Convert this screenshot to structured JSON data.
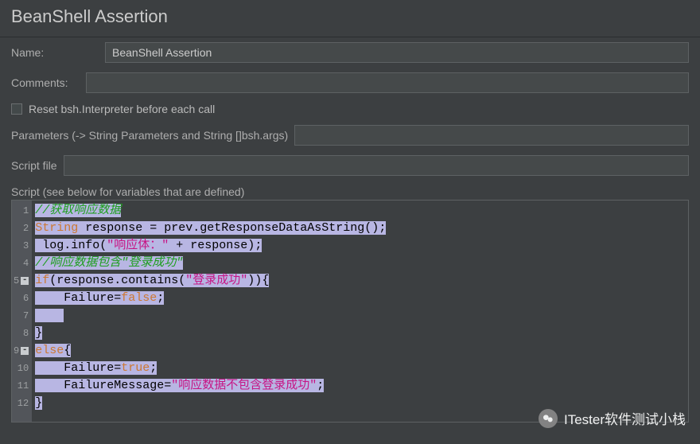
{
  "header": {
    "title": "BeanShell Assertion"
  },
  "fields": {
    "name_label": "Name:",
    "name_value": "BeanShell Assertion",
    "comments_label": "Comments:",
    "comments_value": "",
    "reset_label": "Reset bsh.Interpreter before each call",
    "reset_checked": false,
    "parameters_label": "Parameters (-> String Parameters and String []bsh.args)",
    "parameters_value": "",
    "scriptfile_label": "Script file",
    "scriptfile_value": "",
    "script_label": "Script (see below for variables that are defined)"
  },
  "code": {
    "lines": [
      {
        "n": 1,
        "fold": "",
        "tokens": [
          [
            "comment",
            "//获取响应数据"
          ]
        ]
      },
      {
        "n": 2,
        "fold": "",
        "tokens": [
          [
            "type",
            "String"
          ],
          [
            "ident",
            " response "
          ],
          [
            "op",
            "="
          ],
          [
            "ident",
            " prev.getResponseDataAsString"
          ],
          [
            "paren",
            "()"
          ],
          [
            "op",
            ";"
          ]
        ]
      },
      {
        "n": 3,
        "fold": "",
        "tokens": [
          [
            "ident",
            " log.info"
          ],
          [
            "paren",
            "("
          ],
          [
            "string",
            "\"响应体：\""
          ],
          [
            "ident",
            " "
          ],
          [
            "op",
            "+"
          ],
          [
            "ident",
            " response"
          ],
          [
            "paren",
            ")"
          ],
          [
            "op",
            ";"
          ]
        ]
      },
      {
        "n": 4,
        "fold": "",
        "tokens": [
          [
            "comment",
            "//响应数据包含\"登录成功\""
          ]
        ]
      },
      {
        "n": 5,
        "fold": "-",
        "tokens": [
          [
            "keyword",
            "if"
          ],
          [
            "paren",
            "("
          ],
          [
            "ident",
            "response.contains"
          ],
          [
            "paren",
            "("
          ],
          [
            "string",
            "\"登录成功\""
          ],
          [
            "paren",
            "))"
          ],
          [
            "paren",
            "{"
          ]
        ]
      },
      {
        "n": 6,
        "fold": "",
        "tokens": [
          [
            "ident",
            "    Failure"
          ],
          [
            "op",
            "="
          ],
          [
            "keyword",
            "false"
          ],
          [
            "op",
            ";"
          ]
        ]
      },
      {
        "n": 7,
        "fold": "",
        "tokens": [
          [
            "ident",
            "    "
          ]
        ]
      },
      {
        "n": 8,
        "fold": "",
        "tokens": [
          [
            "paren",
            "}"
          ]
        ]
      },
      {
        "n": 9,
        "fold": "-",
        "tokens": [
          [
            "keyword",
            "else"
          ],
          [
            "paren",
            "{"
          ]
        ]
      },
      {
        "n": 10,
        "fold": "",
        "tokens": [
          [
            "ident",
            "    Failure"
          ],
          [
            "op",
            "="
          ],
          [
            "keyword",
            "true"
          ],
          [
            "op",
            ";"
          ]
        ]
      },
      {
        "n": 11,
        "fold": "",
        "tokens": [
          [
            "ident",
            "    FailureMessage"
          ],
          [
            "op",
            "="
          ],
          [
            "string",
            "\"响应数据不包含登录成功\""
          ],
          [
            "op",
            ";"
          ]
        ]
      },
      {
        "n": 12,
        "fold": "",
        "tokens": [
          [
            "paren",
            "}"
          ]
        ]
      }
    ]
  },
  "watermark": {
    "text": "ITester软件测试小栈"
  }
}
